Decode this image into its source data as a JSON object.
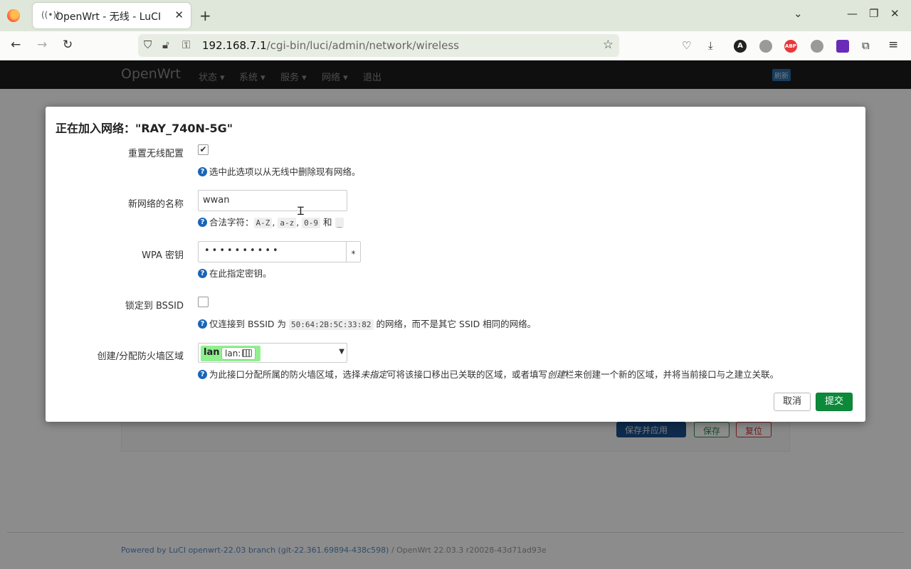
{
  "browser": {
    "tab_title": "OpenWrt - 无线 - LuCI",
    "tab_icon": "((•))",
    "url_host": "192.168.7.1",
    "url_path": "/cgi-bin/luci/admin/network/wireless"
  },
  "luci": {
    "brand": "OpenWrt",
    "menu": [
      "状态 ▾",
      "系统 ▾",
      "服务 ▾",
      "网络 ▾",
      "退出"
    ],
    "refresh": "刷新",
    "buttons": {
      "save_apply": "保存并应用",
      "save": "保存",
      "reset": "复位"
    },
    "footer_link": "Powered by LuCI openwrt-22.03 branch (git-22.361.69894-438c598)",
    "footer_rest": " / OpenWrt 22.03.3 r20028-43d71ad93e"
  },
  "modal": {
    "title": "正在加入网络：\"RAY_740N-5G\"",
    "reset_wireless": {
      "label": "重置无线配置",
      "checked": true,
      "help": "选中此选项以从无线中删除现有网络。"
    },
    "network_name": {
      "label": "新网络的名称",
      "value": "wwan",
      "help_prefix": "合法字符：",
      "chars": [
        "A-Z",
        "a-z",
        "0-9",
        "_"
      ],
      "and": "和"
    },
    "wpa_key": {
      "label": "WPA 密钥",
      "masked_value": "••••••••••",
      "toggle": "*",
      "help": "在此指定密钥。"
    },
    "lock_bssid": {
      "label": "锁定到 BSSID",
      "checked": false,
      "help_prefix": "仅连接到 BSSID 为",
      "bssid": "50:64:2B:5C:33:82",
      "help_suffix": "的网络，而不是其它 SSID 相同的网络。"
    },
    "firewall_zone": {
      "label": "创建/分配防火墙区域",
      "zone": "lan",
      "network": "lan:",
      "help_1": "为此接口分配所属的防火墙区域，选择",
      "help_em1": "未指定",
      "help_2": "可将该接口移出已关联的区域，或者填写",
      "help_em2": "创建",
      "help_3": "栏来创建一个新的区域，并将当前接口与之建立关联。"
    },
    "cancel": "取消",
    "submit": "提交"
  },
  "colors": {
    "submit_green": "#0c8a3a",
    "zone_green": "#90f090",
    "help_blue": "#1a64b8"
  }
}
